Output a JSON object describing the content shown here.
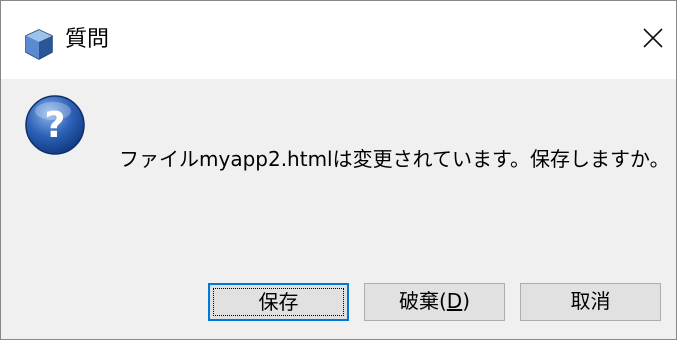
{
  "window": {
    "title": "質問",
    "app_icon": "cube-icon",
    "close_icon": "close-icon"
  },
  "dialog": {
    "icon": "question-icon",
    "message": "ファイルmyapp2.htmlは変更されています。保存しますか。"
  },
  "buttons": {
    "save_label": "保存",
    "discard_prefix": "破棄(",
    "discard_mnemonic": "D",
    "discard_suffix": ")",
    "cancel_label": "取消"
  },
  "colors": {
    "accent": "#0078d7",
    "dialog_bg": "#f0f0f0",
    "titlebar_bg": "#ffffff",
    "button_bg": "#e1e1e1"
  }
}
